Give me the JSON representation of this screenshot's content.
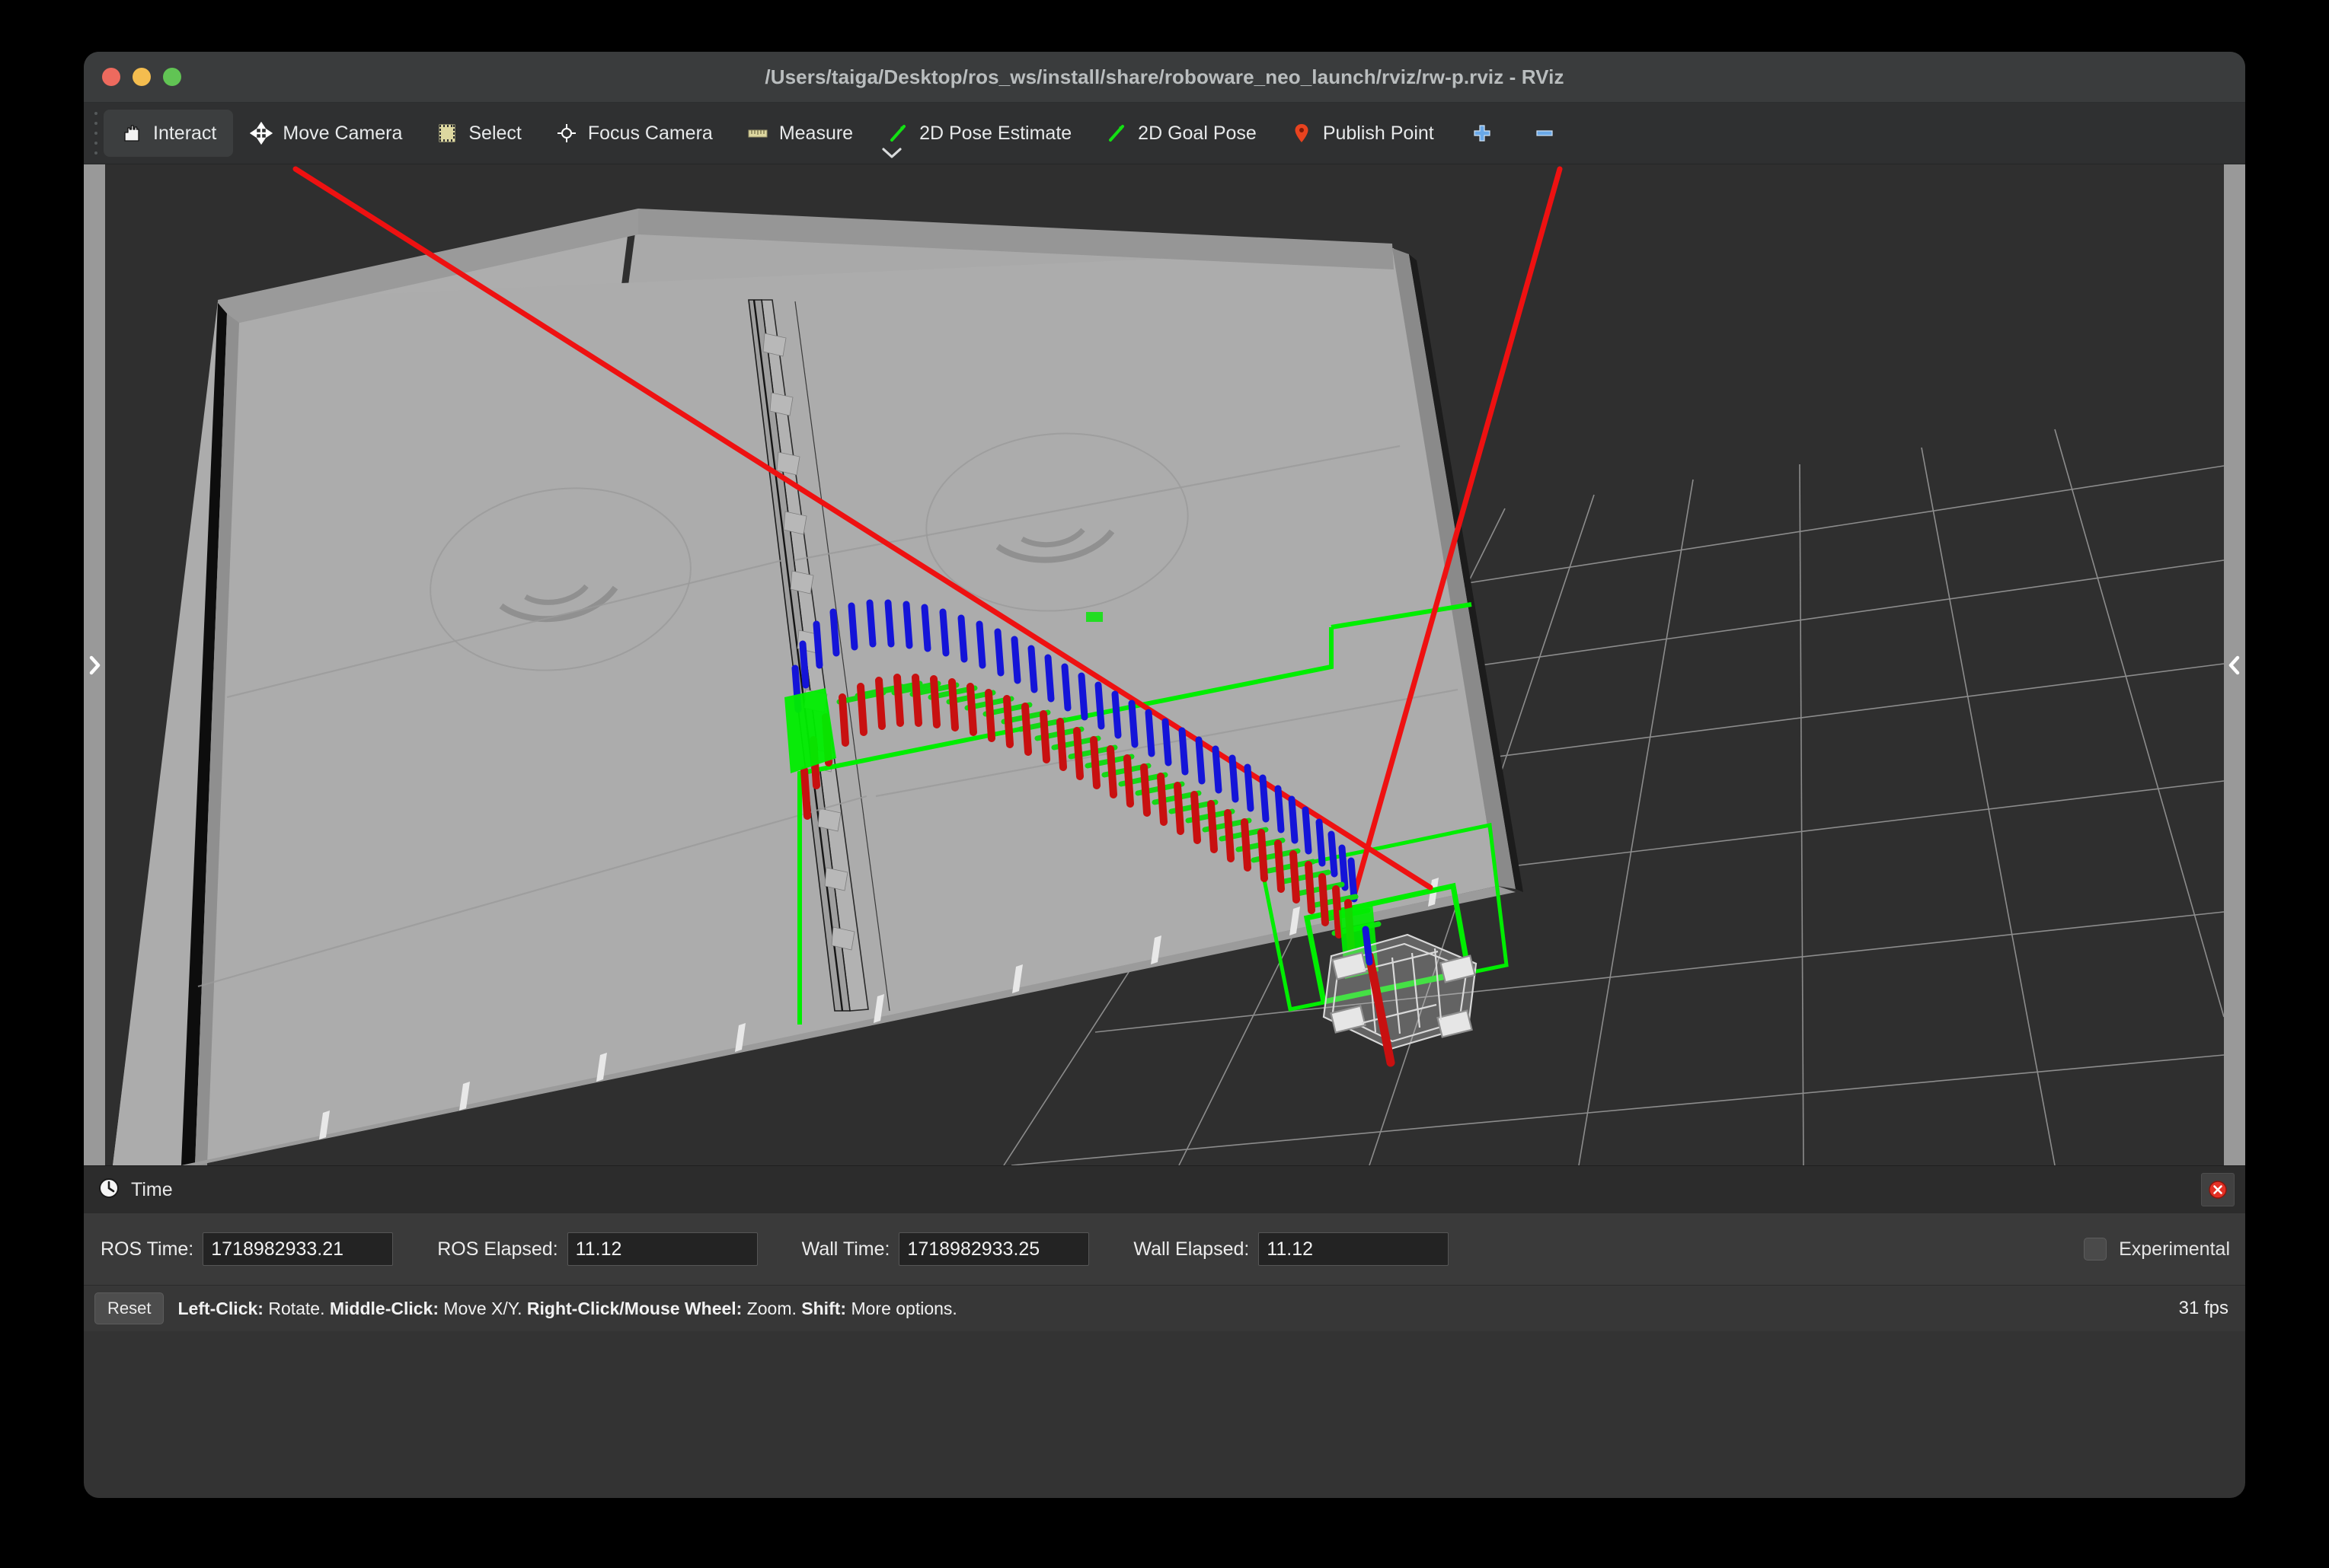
{
  "window": {
    "title": "/Users/taiga/Desktop/ros_ws/install/share/roboware_neo_launch/rviz/rw-p.rviz - RViz",
    "traffic_lights": [
      "close",
      "minimize",
      "zoom"
    ]
  },
  "toolbar": {
    "items": [
      {
        "label": "Interact",
        "icon": "hand-icon",
        "active": true
      },
      {
        "label": "Move Camera",
        "icon": "move-camera-icon",
        "active": false
      },
      {
        "label": "Select",
        "icon": "select-icon",
        "active": false
      },
      {
        "label": "Focus Camera",
        "icon": "focus-camera-icon",
        "active": false
      },
      {
        "label": "Measure",
        "icon": "ruler-icon",
        "active": false
      },
      {
        "label": "2D Pose Estimate",
        "icon": "green-arrow-icon",
        "active": false
      },
      {
        "label": "2D Goal Pose",
        "icon": "green-arrow-icon",
        "active": false
      },
      {
        "label": "Publish Point",
        "icon": "map-pin-icon",
        "active": false
      }
    ],
    "add_tool_label": "+",
    "remove_tool_label": "−",
    "overflow_label": "⌄"
  },
  "viewport": {
    "background_color": "#2f2f2f",
    "grid_color": "#b4b4b4",
    "floor_color": "#a9a9a9",
    "path_marker_colors": {
      "x_axis": "#cc0000",
      "y_axis": "#00cc00",
      "z_axis": "#0000cc"
    },
    "axis_line_color": "#ee1111",
    "footprint_color": "#00ee00",
    "marker_dot_color": "#22dd22"
  },
  "time_panel": {
    "title": "Time",
    "icon": "clock-icon",
    "close_icon": "close-icon",
    "fields": [
      {
        "label": "ROS Time:",
        "value": "1718982933.21"
      },
      {
        "label": "ROS Elapsed:",
        "value": "11.12"
      },
      {
        "label": "Wall Time:",
        "value": "1718982933.25"
      },
      {
        "label": "Wall Elapsed:",
        "value": "11.12"
      }
    ],
    "experimental": {
      "label": "Experimental",
      "checked": false
    }
  },
  "status_bar": {
    "reset_label": "Reset",
    "hint_parts": [
      {
        "text": "Left-Click:",
        "bold": true
      },
      {
        "text": " Rotate. ",
        "bold": false
      },
      {
        "text": "Middle-Click:",
        "bold": true
      },
      {
        "text": " Move X/Y. ",
        "bold": false
      },
      {
        "text": "Right-Click/Mouse Wheel:",
        "bold": true
      },
      {
        "text": " Zoom. ",
        "bold": false
      },
      {
        "text": "Shift:",
        "bold": true
      },
      {
        "text": " More options.",
        "bold": false
      }
    ],
    "fps": "31 fps"
  },
  "splitters": {
    "left_icon": "chevron-right-icon",
    "right_icon": "chevron-left-icon"
  }
}
